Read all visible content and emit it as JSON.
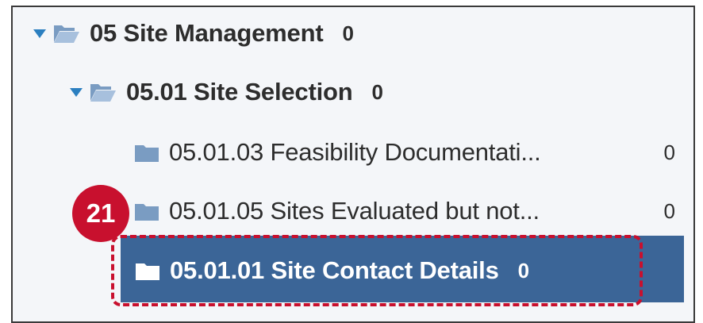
{
  "tree": {
    "items": [
      {
        "label": "05 Site Management",
        "count": "0",
        "expanded": true,
        "icon": "folder-open-icon"
      },
      {
        "label": "05.01 Site Selection",
        "count": "0",
        "expanded": true,
        "icon": "folder-open-icon"
      },
      {
        "label": "05.01.03 Feasibility Documentati...",
        "count": "0",
        "icon": "folder-icon"
      },
      {
        "label": "05.01.05 Sites Evaluated but not...",
        "count": "0",
        "icon": "folder-icon"
      },
      {
        "label": "05.01.01 Site Contact Details",
        "count": "0",
        "icon": "folder-icon",
        "selected": true
      }
    ]
  },
  "callout": {
    "number": "21",
    "color": "#c8102e"
  },
  "colors": {
    "selected_bg": "#3b6597",
    "folder": "#7a9cc2",
    "caret": "#2b7fc0"
  }
}
